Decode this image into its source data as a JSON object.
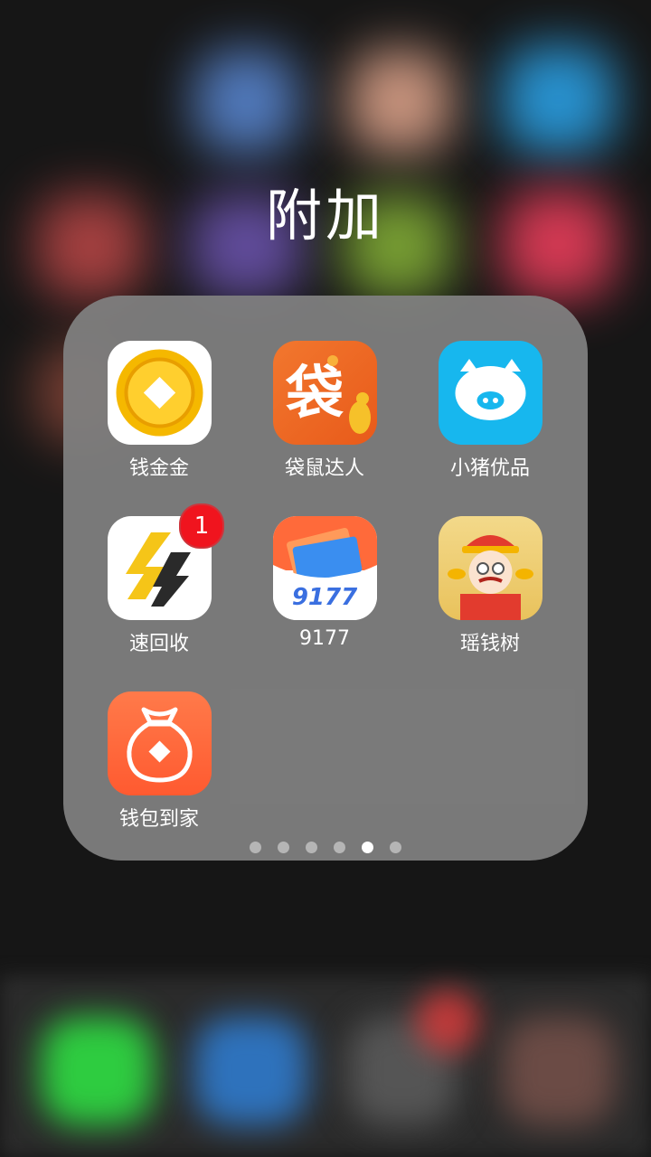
{
  "folder": {
    "title": "附加",
    "apps": [
      {
        "label": "钱金金",
        "icon": "gold-coin-icon"
      },
      {
        "label": "袋鼠达人",
        "icon": "kangaroo-bag-icon",
        "icon_text": "袋"
      },
      {
        "label": "小猪优品",
        "icon": "piggy-icon"
      },
      {
        "label": "速回收",
        "icon": "lightning-icon",
        "badge": "1"
      },
      {
        "label": "9177",
        "icon": "wallet-cards-icon",
        "icon_text": "9177"
      },
      {
        "label": "瑶钱树",
        "icon": "fortune-god-icon"
      },
      {
        "label": "钱包到家",
        "icon": "money-bag-icon"
      }
    ],
    "page_dots": {
      "count": 6,
      "active_index": 4
    }
  },
  "colors": {
    "folder_bg": "#808080",
    "badge": "#f0141e",
    "coin_yellow": "#f5b800",
    "kangaroo_orange": "#ef6a23",
    "piggy_blue": "#17b7ee",
    "wallet_bag_orange": "#ff6a3a"
  }
}
